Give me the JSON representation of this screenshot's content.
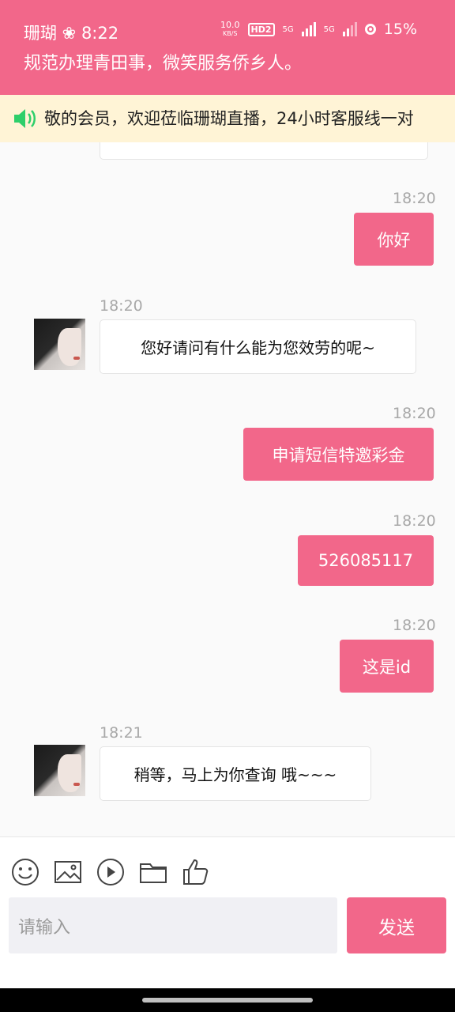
{
  "status_bar": {
    "left_text": "珊瑚 ❀ 8:22",
    "net_speed_value": "10.0",
    "net_speed_unit": "KB/S",
    "hd_badge": "HD2",
    "signal_1": "5G",
    "signal_2": "5G",
    "battery": "15%"
  },
  "header": {
    "title": "规范办理青田事，微笑服务侨乡人。"
  },
  "notice": {
    "icon": "speaker-icon",
    "text": "敬的会员，欢迎莅临珊瑚直播，24小时客服线一对"
  },
  "messages": [
    {
      "time": "18:20",
      "text": "你好"
    },
    {
      "time": "18:20",
      "text": "您好请问有什么能为您效劳的呢~"
    },
    {
      "time": "18:20",
      "text": "申请短信特邀彩金"
    },
    {
      "time": "18:20",
      "text": "526085117"
    },
    {
      "time": "18:20",
      "text": "这是id"
    },
    {
      "time": "18:21",
      "text": "稍等，马上为你查询 哦~~~"
    }
  ],
  "toolbar": {
    "icons": [
      "smiley-icon",
      "image-icon",
      "video-icon",
      "folder-icon",
      "thumbs-up-icon"
    ],
    "input_placeholder": "请输入",
    "send_label": "发送"
  },
  "colors": {
    "accent": "#f2678a",
    "notice_bg": "#fff4d6",
    "chat_bg": "#fafafa"
  }
}
